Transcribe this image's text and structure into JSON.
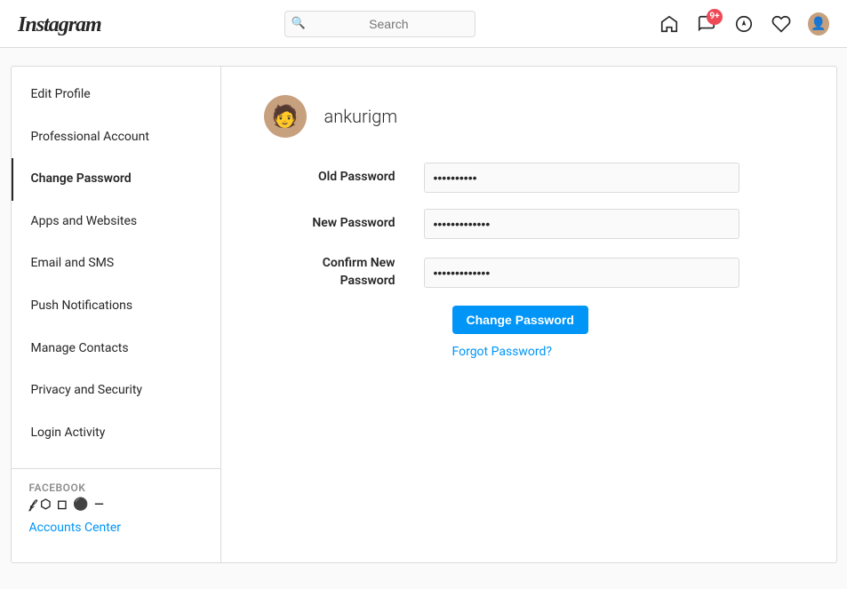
{
  "app": {
    "logo": "Instagram",
    "badge_count": "9+"
  },
  "topnav": {
    "search_placeholder": "Search",
    "icons": {
      "home": "home-icon",
      "notifications": "notifications-icon",
      "explore": "explore-icon",
      "likes": "heart-icon",
      "avatar": "avatar-icon"
    }
  },
  "sidebar": {
    "items": [
      {
        "id": "edit-profile",
        "label": "Edit Profile",
        "active": false
      },
      {
        "id": "professional-account",
        "label": "Professional Account",
        "active": false
      },
      {
        "id": "change-password",
        "label": "Change Password",
        "active": true
      },
      {
        "id": "apps-and-websites",
        "label": "Apps and Websites",
        "active": false
      },
      {
        "id": "email-and-sms",
        "label": "Email and SMS",
        "active": false
      },
      {
        "id": "push-notifications",
        "label": "Push Notifications",
        "active": false
      },
      {
        "id": "manage-contacts",
        "label": "Manage Contacts",
        "active": false
      },
      {
        "id": "privacy-and-security",
        "label": "Privacy and Security",
        "active": false
      },
      {
        "id": "login-activity",
        "label": "Login Activity",
        "active": false
      }
    ],
    "facebook_section": {
      "title": "FACEBOOK",
      "icons": [
        "facebook-icon",
        "messenger-icon",
        "instagram-icon",
        "whatsapp-icon",
        "oculus-icon"
      ]
    },
    "accounts_center": {
      "label": "Accounts Center"
    }
  },
  "content": {
    "username": "ankurigm",
    "form": {
      "old_password_label": "Old Password",
      "old_password_value": "••••••••••",
      "new_password_label": "New Password",
      "new_password_value": "•••••••••••••",
      "confirm_password_label": "Confirm New Password",
      "confirm_password_value": "•••••••••••••",
      "submit_button": "Change Password",
      "forgot_link": "Forgot Password?"
    }
  }
}
